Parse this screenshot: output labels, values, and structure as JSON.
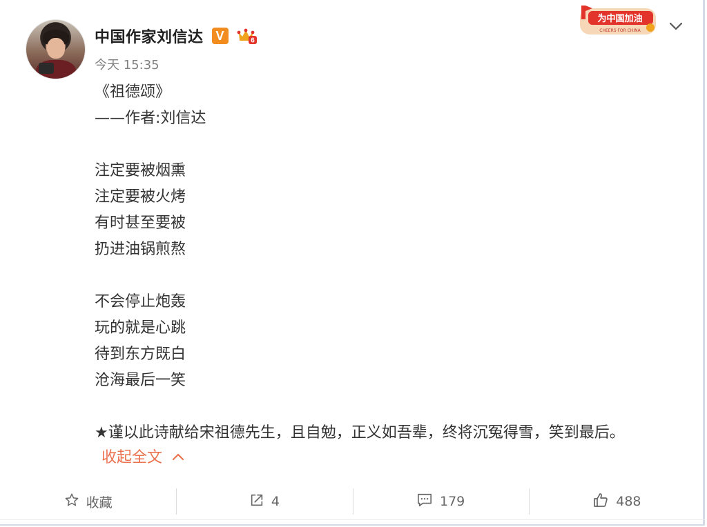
{
  "post": {
    "username": "中国作家刘信达",
    "timestamp": "今天 15:35",
    "banner": {
      "title": "为中国加油",
      "subtitle": "CHEERS FOR CHINA",
      "colors": {
        "bg": "#f6d7b8",
        "ribbon": "#e2342a",
        "text": "#ffffff"
      }
    },
    "content_lines": [
      "《祖德颂》",
      "——作者:刘信达",
      "",
      "注定要被烟熏",
      "注定要被火烤",
      "有时甚至要被",
      "扔进油锅煎熬",
      "",
      "不会停止炮轰",
      "玩的就是心跳",
      "待到东方既白",
      "沧海最后一笑",
      "",
      "★谨以此诗献给宋祖德先生，且自勉，正义如吾辈，终将沉冤得雪，笑到最后。"
    ],
    "collapse_label": "收起全文",
    "accent_color": "#eb7350"
  },
  "actions": [
    {
      "icon": "star-icon",
      "label": "收藏"
    },
    {
      "icon": "share-icon",
      "label": "4"
    },
    {
      "icon": "comment-icon",
      "label": "179"
    },
    {
      "icon": "like-icon",
      "label": "488"
    }
  ]
}
